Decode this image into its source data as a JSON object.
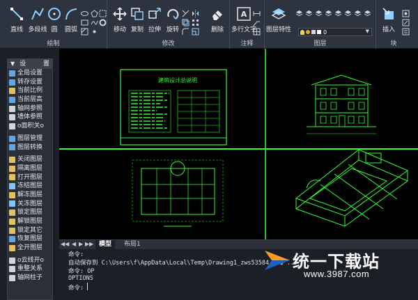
{
  "ribbon": {
    "panels": [
      {
        "title": "绘制"
      },
      {
        "title": "修改"
      },
      {
        "title": "注释"
      },
      {
        "title": "图层"
      },
      {
        "title": "块"
      }
    ],
    "draw": {
      "line": "直线",
      "polyline": "多段线",
      "circle": "圆",
      "arc": "圆弧"
    },
    "modify": {
      "move": "移动",
      "copy": "复制",
      "stretch": "拉伸",
      "rotate": "旋转",
      "erase": "删除"
    },
    "annotate": {
      "mtext": "多行文字"
    },
    "layers": {
      "properties": "图层特性",
      "current_layer": "0"
    },
    "block": {
      "insert": "插入"
    }
  },
  "palette": {
    "title": "设",
    "title2": "置",
    "items": [
      {
        "label": "全局设置",
        "icon": "settings-icon",
        "color": "#5aa9e6"
      },
      {
        "label": "转存设置",
        "icon": "save-icon",
        "color": "#5aa9e6"
      },
      {
        "label": "当前比例",
        "icon": "scale-icon",
        "color": "#e6c15a"
      },
      {
        "label": "当前层高",
        "icon": "height-icon",
        "color": "#5aa9e6"
      },
      {
        "label": "轴网参照",
        "icon": "grid-icon",
        "color": "#cfd6e0"
      },
      {
        "label": "墙体参照",
        "icon": "wall-icon",
        "color": "#cfd6e0"
      },
      {
        "label": "o面积关o",
        "icon": "area-icon",
        "color": "#cfd6e0"
      },
      {
        "label": "图层管理",
        "icon": "layer-manager-icon",
        "color": "#5aa9e6"
      },
      {
        "label": "图层转换",
        "icon": "layer-convert-icon",
        "color": "#5aa9e6"
      },
      {
        "label": "关闭图层",
        "icon": "layer-off-icon",
        "color": "#e6c15a"
      },
      {
        "label": "隔离图层",
        "icon": "layer-isolate-icon",
        "color": "#e6c15a"
      },
      {
        "label": "打开图层",
        "icon": "layer-on-icon",
        "color": "#e6c15a"
      },
      {
        "label": "冻结图层",
        "icon": "layer-freeze-icon",
        "color": "#7fc6ff"
      },
      {
        "label": "解冻图层",
        "icon": "layer-thaw-icon",
        "color": "#e6c15a"
      },
      {
        "label": "关冻图层",
        "icon": "layer-off-freeze-icon",
        "color": "#7fc6ff"
      },
      {
        "label": "锁定图层",
        "icon": "layer-lock-icon",
        "color": "#e6c15a"
      },
      {
        "label": "解锁图层",
        "icon": "layer-unlock-icon",
        "color": "#e6c15a"
      },
      {
        "label": "锁定其它",
        "icon": "lock-others-icon",
        "color": "#e6c15a"
      },
      {
        "label": "恢复图层",
        "icon": "layer-restore-icon",
        "color": "#5aa9e6"
      },
      {
        "label": "全开图层",
        "icon": "layer-all-on-icon",
        "color": "#e6c15a"
      },
      {
        "label": "o云线开o",
        "icon": "revcloud-icon",
        "color": "#cfd6e0"
      },
      {
        "label": "重整关系",
        "icon": "rebuild-icon",
        "color": "#cfd6e0"
      },
      {
        "label": "轴网柱子",
        "icon": "column-icon",
        "color": "#cfd6e0"
      }
    ]
  },
  "drawing": {
    "sheet_title": "建筑设计总说明"
  },
  "tabs": {
    "model": "模型",
    "layout1": "布局1"
  },
  "command": {
    "lines": [
      "命令:",
      "自动保存到 C:\\Users\\f\\AppData\\Local\\Temp\\Drawing1_zws53584.zs$ ...",
      "命令: OP",
      "OPTIONS"
    ],
    "prompt": "命令:"
  },
  "watermark": {
    "brand": "统一下载站",
    "url": "www.3987.com"
  },
  "colors": {
    "ribbon_bg": "#2e343f",
    "canvas_bg": "#000000",
    "drawing_green": "#33ff33",
    "accent_blue": "#5aa9e6"
  }
}
